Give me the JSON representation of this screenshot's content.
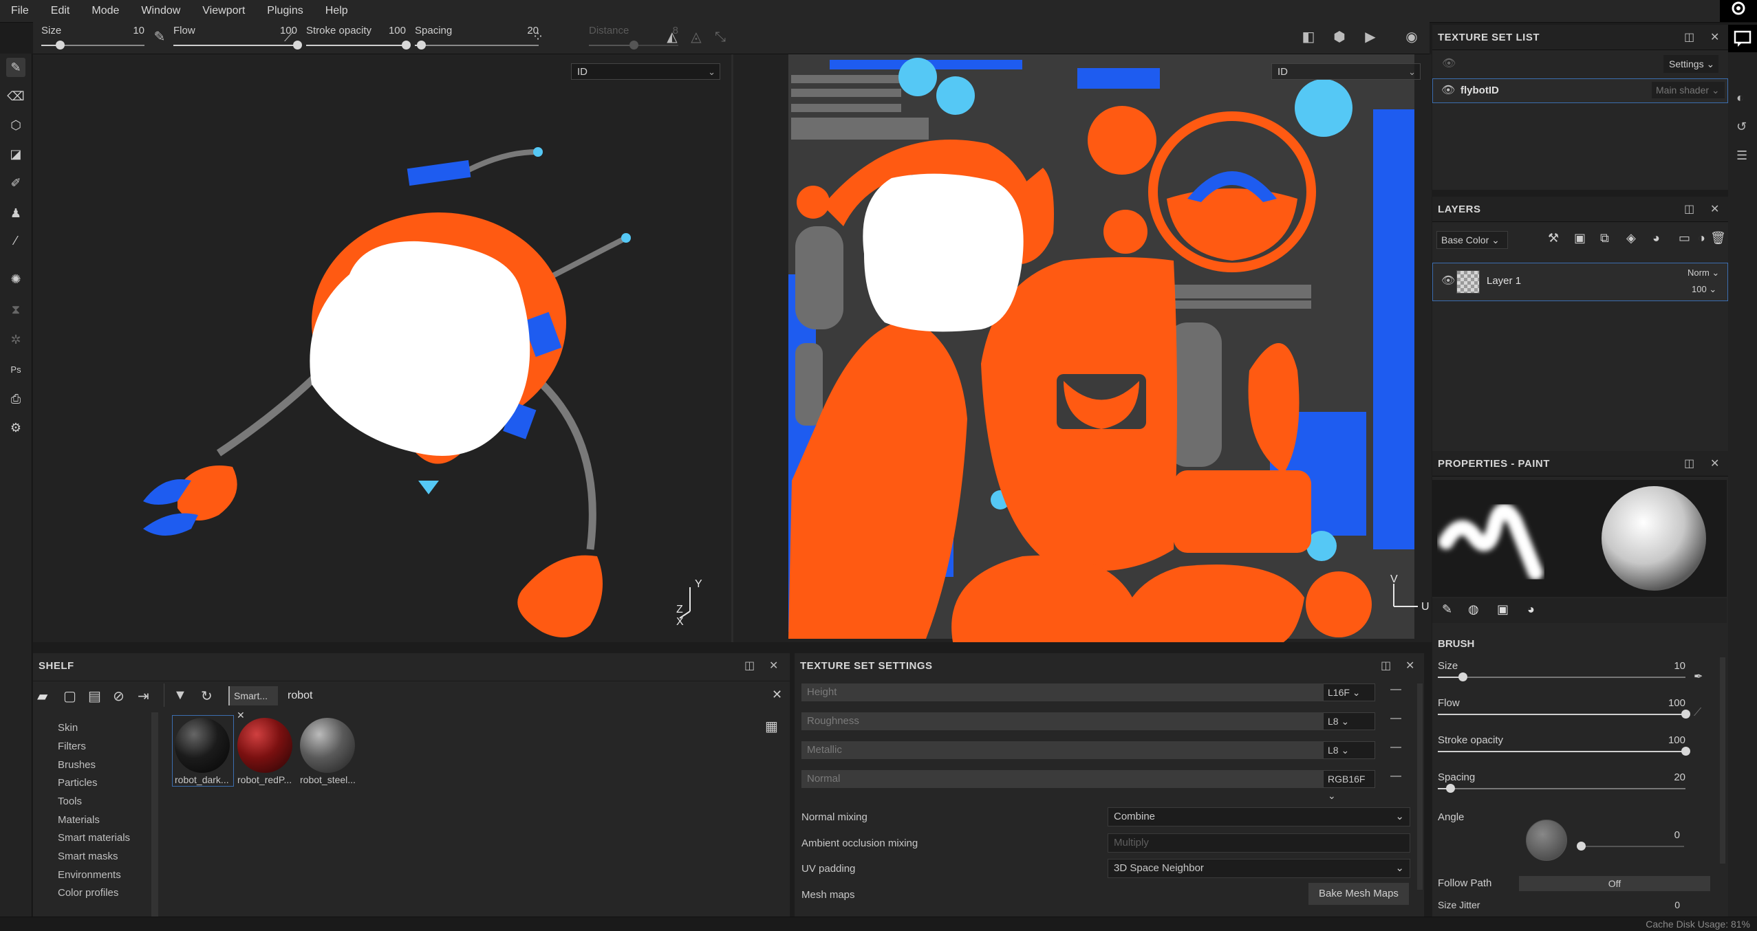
{
  "menu": [
    "File",
    "Edit",
    "Mode",
    "Window",
    "Viewport",
    "Plugins",
    "Help"
  ],
  "toolbar": {
    "params": [
      {
        "label": "Size",
        "value": "10",
        "level": 0.18
      },
      {
        "label": "Flow",
        "value": "100",
        "level": 1.0
      },
      {
        "label": "Stroke opacity",
        "value": "100",
        "level": 1.0
      },
      {
        "label": "Spacing",
        "value": "20",
        "level": 0.05
      },
      {
        "label": "Distance",
        "value": "8",
        "level": 0.5,
        "disabled": true
      }
    ]
  },
  "viewport3d": {
    "channel": "ID",
    "axes": {
      "y": "Y",
      "z": "Z",
      "x": "X"
    }
  },
  "viewport2d": {
    "channel": "ID",
    "axes": {
      "v": "V",
      "u": "U"
    }
  },
  "texture_set_list": {
    "title": "TEXTURE SET LIST",
    "settings_label": "Settings",
    "item_name": "flybotID",
    "item_shader": "Main shader"
  },
  "layers": {
    "title": "LAYERS",
    "channel": "Base Color",
    "layer_name": "Layer 1",
    "blend": "Norm",
    "opacity": "100"
  },
  "properties": {
    "title": "PROPERTIES - PAINT",
    "section": "BRUSH",
    "params": [
      {
        "label": "Size",
        "value": "10",
        "level": 0.1
      },
      {
        "label": "Flow",
        "value": "100",
        "level": 1.0
      },
      {
        "label": "Stroke opacity",
        "value": "100",
        "level": 1.0
      },
      {
        "label": "Spacing",
        "value": "20",
        "level": 0.05
      }
    ],
    "angle_label": "Angle",
    "angle_value": "0",
    "follow_path_label": "Follow Path",
    "follow_path_value": "Off",
    "size_jitter_label": "Size Jitter",
    "size_jitter_value": "0"
  },
  "shelf": {
    "title": "SHELF",
    "filter_tag": "Smart...",
    "search": "robot",
    "categories": [
      "Skin",
      "Filters",
      "Brushes",
      "Particles",
      "Tools",
      "Materials",
      "Smart materials",
      "Smart masks",
      "Environments",
      "Color profiles"
    ],
    "items": [
      {
        "label": "robot_dark...",
        "color": "#1b1b1b"
      },
      {
        "label": "robot_redP...",
        "color": "#7a1010"
      },
      {
        "label": "robot_steel...",
        "color": "#5a5a5a"
      }
    ]
  },
  "texture_set_settings": {
    "title": "TEXTURE SET SETTINGS",
    "channels": [
      {
        "name": "Height",
        "format": "L16F"
      },
      {
        "name": "Roughness",
        "format": "L8"
      },
      {
        "name": "Metallic",
        "format": "L8"
      },
      {
        "name": "Normal",
        "format": "RGB16F"
      }
    ],
    "normal_mixing_label": "Normal mixing",
    "normal_mixing_value": "Combine",
    "ao_mixing_label": "Ambient occlusion mixing",
    "ao_mixing_value": "Multiply",
    "uv_padding_label": "UV padding",
    "uv_padding_value": "3D Space Neighbor",
    "mesh_maps_label": "Mesh maps",
    "bake_button": "Bake Mesh Maps"
  },
  "status": {
    "cache": "Cache Disk Usage:  81%"
  },
  "colors": {
    "orange": "#ff5a12",
    "blue": "#1e5cf0",
    "cyan": "#55c8f5",
    "gray": "#6e6e6e"
  }
}
